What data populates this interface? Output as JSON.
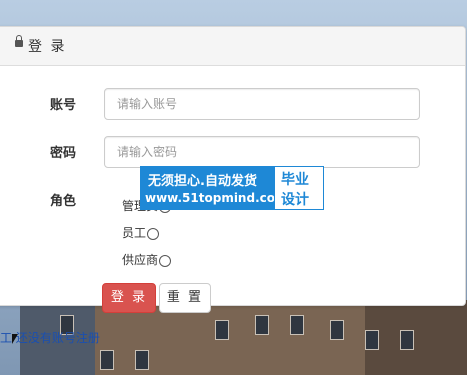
{
  "header": {
    "title": "登 录"
  },
  "form": {
    "account_label": "账号",
    "account_placeholder": "请输入账号",
    "password_label": "密码",
    "password_placeholder": "请输入密码",
    "role_label": "角色",
    "roles": [
      "管理员",
      "员工",
      "供应商"
    ]
  },
  "buttons": {
    "login": "登 录",
    "reset": "重 置"
  },
  "footer": {
    "link": "工 还没有账号注册"
  },
  "watermark": {
    "line1": "无须担心.自动发货",
    "line2": "www.51topmind.com",
    "right1": "毕业",
    "right2": "设计"
  },
  "colors": {
    "login_button": "#d9534f",
    "watermark_blue": "#1e88d6"
  }
}
